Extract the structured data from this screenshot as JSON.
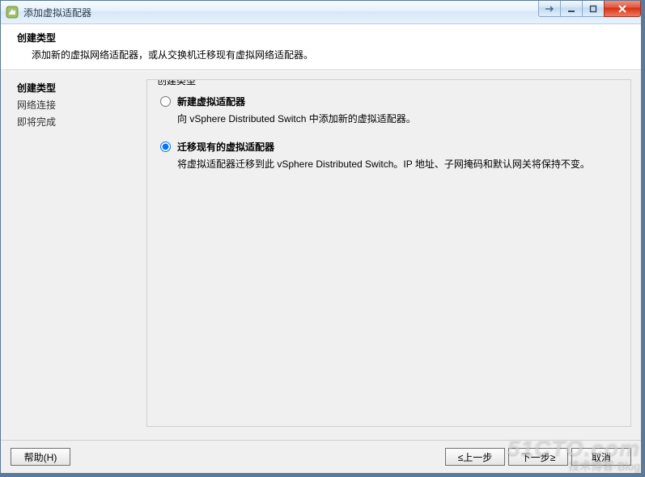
{
  "window": {
    "title": "添加虚拟适配器"
  },
  "header": {
    "title": "创建类型",
    "subtitle": "添加新的虚拟网络适配器，或从交换机迁移现有虚拟网络适配器。"
  },
  "sidebar": {
    "steps": [
      {
        "label": "创建类型",
        "current": true
      },
      {
        "label": "网络连接",
        "current": false
      },
      {
        "label": "即将完成",
        "current": false
      }
    ]
  },
  "main": {
    "group_legend": "创建类型",
    "options": [
      {
        "id": "opt-new",
        "label": "新建虚拟适配器",
        "description": "向 vSphere Distributed Switch 中添加新的虚拟适配器。",
        "selected": false
      },
      {
        "id": "opt-migrate",
        "label": "迁移现有的虚拟适配器",
        "description": "将虚拟适配器迁移到此 vSphere Distributed Switch。IP 地址、子网掩码和默认网关将保持不变。",
        "selected": true
      }
    ]
  },
  "footer": {
    "help": "帮助(H)",
    "back": "≤上一步",
    "next": "下一步≥",
    "cancel": "取消"
  },
  "watermark": {
    "big": "51CTO.com",
    "small": "技术博客·Blog"
  }
}
